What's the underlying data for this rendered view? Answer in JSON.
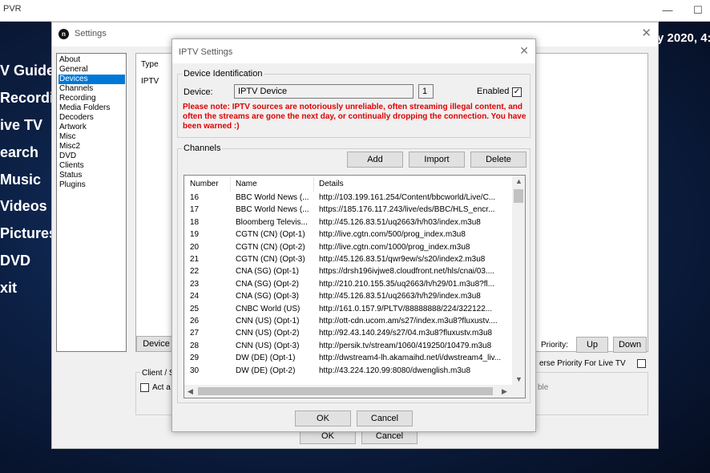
{
  "app": {
    "title": "PVR",
    "clock": "y 2020, 4:",
    "nav": [
      "V Guide",
      "Recordin",
      "ive TV",
      "earch",
      "Music",
      "Videos",
      "Pictures",
      "DVD",
      "xit"
    ],
    "minimize_glyph": "—",
    "maximize_glyph": "☐"
  },
  "settings": {
    "title": "Settings",
    "logo_glyph": "n",
    "close_glyph": "✕",
    "nav_items": [
      "About",
      "General",
      "Devices",
      "Channels",
      "Recording",
      "Media Folders",
      "Decoders",
      "Artwork",
      "Misc",
      "Misc2",
      "DVD",
      "Clients",
      "Status",
      "Plugins"
    ],
    "selected_nav": 2,
    "device_table": {
      "header": "Type",
      "row": "IPTV"
    },
    "device_button": "Device",
    "priority_label": "Priority:",
    "up_button": "Up",
    "down_button": "Down",
    "reverse_priority_label": "erse Priority For Live TV",
    "client_label": "Client / S",
    "act_label": "Act a",
    "ble_label": "ble",
    "ok_button": "OK",
    "cancel_button": "Cancel"
  },
  "iptv": {
    "title": "IPTV Settings",
    "close_glyph": "✕",
    "device_group": "Device Identification",
    "device_label": "Device:",
    "device_value": "IPTV Device",
    "device_number": "1",
    "enabled_label": "Enabled",
    "enabled_checked": true,
    "check_glyph": "✓",
    "warning": "Please note: IPTV sources are notoriously unreliable, often streaming illegal content, and often the streams are gone the next day, or continually dropping the connection. You have been warned :)",
    "channels_group": "Channels",
    "add_button": "Add",
    "import_button": "Import",
    "delete_button": "Delete",
    "columns": [
      "Number",
      "Name",
      "Details"
    ],
    "channels": [
      {
        "number": "16",
        "name": "BBC World News (...",
        "details": "http://103.199.161.254/Content/bbcworld/Live/C..."
      },
      {
        "number": "17",
        "name": "BBC World News (...",
        "details": "https://185.176.117.243/live/eds/BBC/HLS_encr..."
      },
      {
        "number": "18",
        "name": "Bloomberg Televis...",
        "details": "http://45.126.83.51/uq2663/h/h03/index.m3u8"
      },
      {
        "number": "19",
        "name": "CGTN (CN) (Opt-1)",
        "details": "http://live.cgtn.com/500/prog_index.m3u8"
      },
      {
        "number": "20",
        "name": "CGTN (CN) (Opt-2)",
        "details": "http://live.cgtn.com/1000/prog_index.m3u8"
      },
      {
        "number": "21",
        "name": "CGTN (CN) (Opt-3)",
        "details": "http://45.126.83.51/qwr9ew/s/s20/index2.m3u8"
      },
      {
        "number": "22",
        "name": "CNA (SG) (Opt-1)",
        "details": "https://drsh196ivjwe8.cloudfront.net/hls/cnai/03...."
      },
      {
        "number": "23",
        "name": "CNA (SG) (Opt-2)",
        "details": "http://210.210.155.35/uq2663/h/h29/01.m3u8?fl..."
      },
      {
        "number": "24",
        "name": "CNA (SG) (Opt-3)",
        "details": "http://45.126.83.51/uq2663/h/h29/index.m3u8"
      },
      {
        "number": "25",
        "name": "CNBC World (US)",
        "details": "http://161.0.157.9/PLTV/88888888/224/322122..."
      },
      {
        "number": "26",
        "name": "CNN (US) (Opt-1)",
        "details": "http://ott-cdn.ucom.am/s27/index.m3u8?fluxustv...."
      },
      {
        "number": "27",
        "name": "CNN (US) (Opt-2)",
        "details": "http://92.43.140.249/s27/04.m3u8?fluxustv.m3u8"
      },
      {
        "number": "28",
        "name": "CNN (US) (Opt-3)",
        "details": "http://persik.tv/stream/1060/419250/10479.m3u8"
      },
      {
        "number": "29",
        "name": "DW (DE) (Opt-1)",
        "details": "http://dwstream4-lh.akamaihd.net/i/dwstream4_liv..."
      },
      {
        "number": "30",
        "name": "DW (DE) (Opt-2)",
        "details": "http://43.224.120.99:8080/dwenglish.m3u8"
      }
    ],
    "ok_button": "OK",
    "cancel_button": "Cancel"
  }
}
